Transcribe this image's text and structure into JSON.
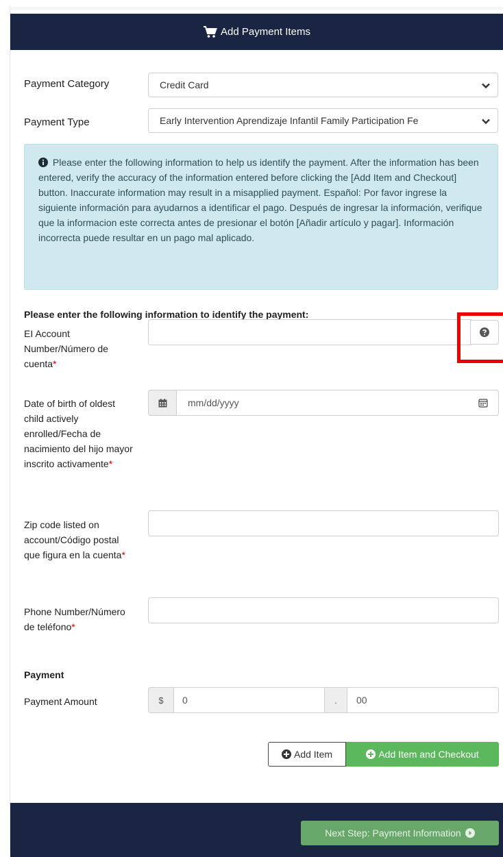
{
  "header": {
    "title": "Add Payment Items",
    "icon": "cart-icon"
  },
  "payment_category": {
    "label": "Payment Category",
    "value": "Credit Card"
  },
  "payment_type": {
    "label": "Payment Type",
    "value": "Early Intervention Aprendizaje Infantil Family Participation Fe"
  },
  "alert": {
    "text": "Please enter the following information to help us identify the payment. After the information has been entered, verify the accuracy of the information entered before clicking the [Add Item and Checkout] button. Inaccurate information may result in a misapplied payment. Español: Por favor ingrese la siguiente información para ayudarnos a identificar el pago. Después de ingresar la información, verifique que la informacion este correcta antes de presionar el botón [Añadir artículo y pagar]. Información incorrecta puede resultar en un pago mal aplicado."
  },
  "identify_heading": "Please enter the following information to identify the payment:",
  "fields": {
    "account": {
      "label": "EI Account Number/Número de cuenta",
      "value": ""
    },
    "dob": {
      "label": "Date of birth of oldest child actively enrolled/Fecha de nacimiento del hijo mayor inscrito activamente",
      "placeholder": "mm/dd/yyyy"
    },
    "zip": {
      "label": "Zip code listed on account/Código postal que figura en la cuenta",
      "value": ""
    },
    "phone": {
      "label": "Phone Number/Número de teléfono",
      "value": ""
    }
  },
  "payment": {
    "heading": "Payment",
    "amount_label": "Payment Amount",
    "currency_symbol": "$",
    "dollars": "0",
    "separator": ".",
    "cents": "00"
  },
  "required_mark": "*",
  "buttons": {
    "add_item": "Add Item",
    "add_item_checkout": "Add Item and Checkout",
    "next_step": "Next Step: Payment Information"
  },
  "colors": {
    "navy": "#1a2544",
    "green": "#5cb85c",
    "alert_bg": "#cfe9ee",
    "highlight": "#ee0000"
  }
}
